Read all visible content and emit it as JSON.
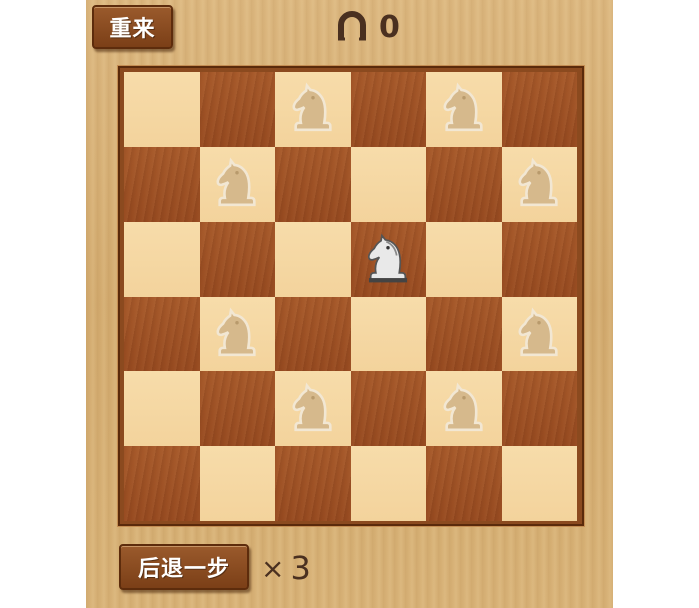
{
  "header": {
    "restart_label": "重来",
    "score_icon": "horseshoe-icon",
    "score_value": "0"
  },
  "footer": {
    "undo_label": "后退一步",
    "undo_times_symbol": "×",
    "undo_count": "3"
  },
  "board": {
    "size": 6,
    "colors": {
      "light": "#f5d8a3",
      "dark": "#9e5124",
      "frame": "#8b4a1f",
      "ghost_knight": "#d6b98c",
      "active_knight": "#e9e9e9"
    },
    "pieces": [
      {
        "type": "ghost-knight",
        "row": 0,
        "col": 2
      },
      {
        "type": "ghost-knight",
        "row": 0,
        "col": 4
      },
      {
        "type": "ghost-knight",
        "row": 1,
        "col": 1
      },
      {
        "type": "ghost-knight",
        "row": 1,
        "col": 5
      },
      {
        "type": "active-knight",
        "row": 2,
        "col": 3
      },
      {
        "type": "ghost-knight",
        "row": 3,
        "col": 1
      },
      {
        "type": "ghost-knight",
        "row": 3,
        "col": 5
      },
      {
        "type": "ghost-knight",
        "row": 4,
        "col": 2
      },
      {
        "type": "ghost-knight",
        "row": 4,
        "col": 4
      }
    ]
  }
}
